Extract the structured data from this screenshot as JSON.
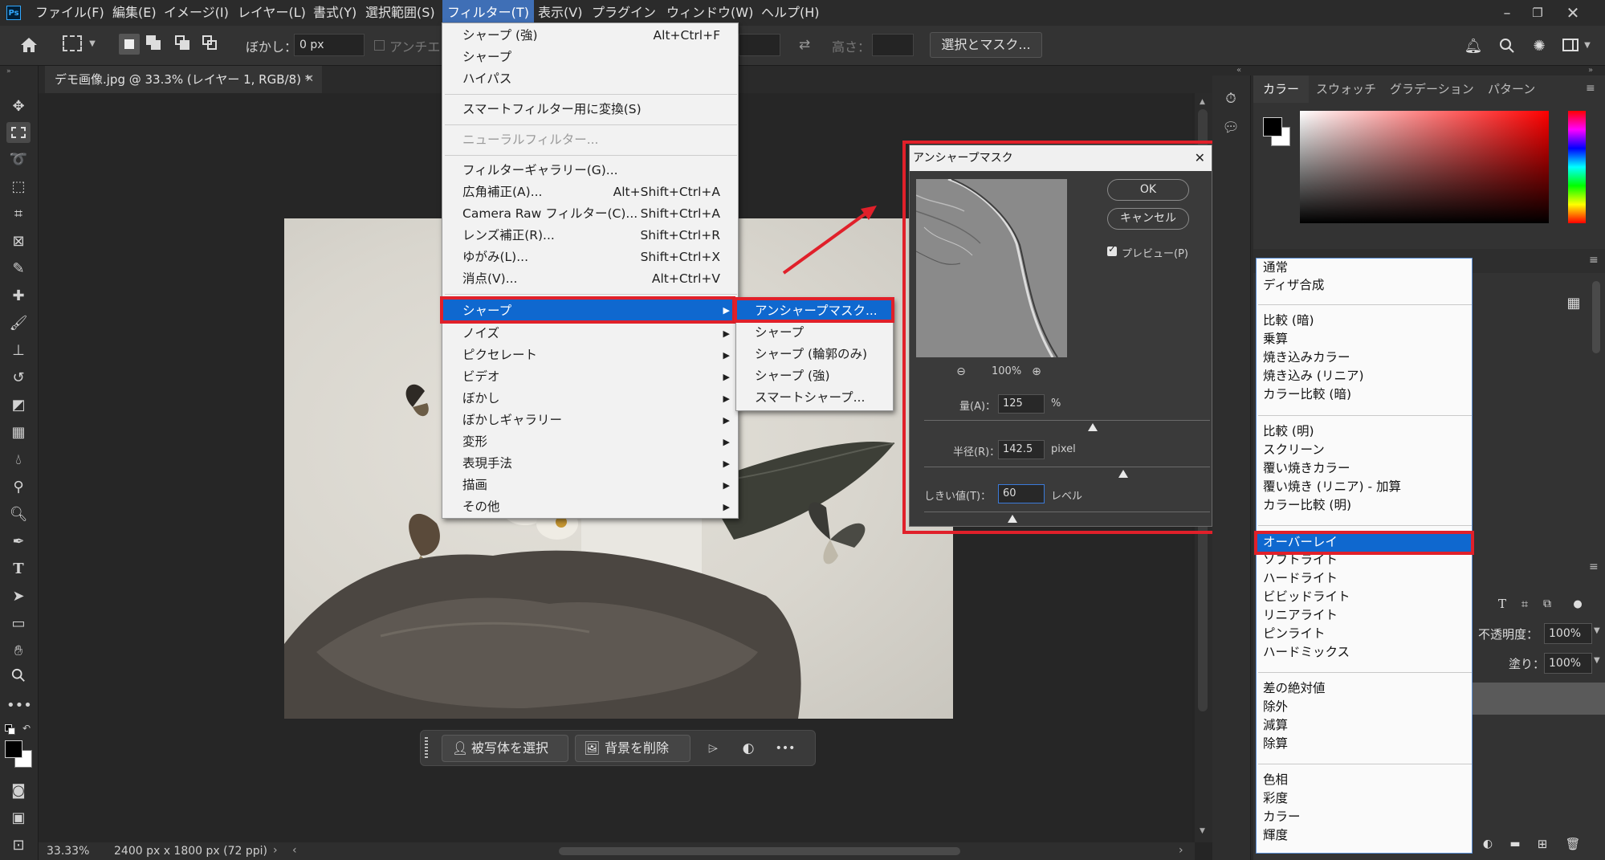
{
  "menubar": {
    "items": [
      "ファイル(F)",
      "編集(E)",
      "イメージ(I)",
      "レイヤー(L)",
      "書式(Y)",
      "選択範囲(S)",
      "フィルター(T)",
      "表示(V)",
      "プラグイン",
      "ウィンドウ(W)",
      "ヘルプ(H)"
    ],
    "active_index": 6
  },
  "options": {
    "blur_label": "ぼかし：",
    "blur_value": "0 px",
    "antialias_label": "アンチエ",
    "height_label": "高さ：",
    "select_mask_button": "選択とマスク..."
  },
  "document": {
    "tab_title": "デモ画像.jpg @ 33.3% (レイヤー 1, RGB/8) *"
  },
  "status": {
    "zoom": "33.33%",
    "doc_info": "2400 px x 1800 px (72 ppi)"
  },
  "context_bar": {
    "select_subject": "被写体を選択",
    "remove_bg": "背景を削除"
  },
  "filter_menu": {
    "items": [
      {
        "label": "シャープ (強)",
        "shortcut": "Alt+Ctrl+F"
      },
      {
        "label": "シャープ",
        "shortcut": ""
      },
      {
        "label": "ハイパス",
        "shortcut": ""
      },
      {
        "label": "スマートフィルター用に変換(S)",
        "shortcut": ""
      },
      {
        "label": "ニューラルフィルター...",
        "shortcut": ""
      },
      {
        "label": "フィルターギャラリー(G)...",
        "shortcut": ""
      },
      {
        "label": "広角補正(A)...",
        "shortcut": "Alt+Shift+Ctrl+A"
      },
      {
        "label": "Camera Raw フィルター(C)...",
        "shortcut": "Shift+Ctrl+A"
      },
      {
        "label": "レンズ補正(R)...",
        "shortcut": "Shift+Ctrl+R"
      },
      {
        "label": "ゆがみ(L)...",
        "shortcut": "Shift+Ctrl+X"
      },
      {
        "label": "消点(V)...",
        "shortcut": "Alt+Ctrl+V"
      },
      {
        "label": "シャープ",
        "shortcut": ""
      },
      {
        "label": "ノイズ",
        "shortcut": ""
      },
      {
        "label": "ピクセレート",
        "shortcut": ""
      },
      {
        "label": "ビデオ",
        "shortcut": ""
      },
      {
        "label": "ぼかし",
        "shortcut": ""
      },
      {
        "label": "ぼかしギャラリー",
        "shortcut": ""
      },
      {
        "label": "変形",
        "shortcut": ""
      },
      {
        "label": "表現手法",
        "shortcut": ""
      },
      {
        "label": "描画",
        "shortcut": ""
      },
      {
        "label": "その他",
        "shortcut": ""
      }
    ]
  },
  "sharpen_submenu": {
    "items": [
      "アンシャープマスク...",
      "シャープ",
      "シャープ (輪郭のみ)",
      "シャープ (強)",
      "スマートシャープ..."
    ]
  },
  "unsharp_dialog": {
    "title": "アンシャープマスク",
    "ok": "OK",
    "cancel": "キャンセル",
    "preview_label": "プレビュー(P)",
    "zoom": "100%",
    "amount_label": "量(A)：",
    "amount_value": "125",
    "amount_unit": "%",
    "radius_label": "半径(R)：",
    "radius_value": "142.5",
    "radius_unit": "pixel",
    "threshold_label": "しきい値(T)：",
    "threshold_value": "60",
    "threshold_unit": "レベル"
  },
  "color_panel": {
    "tabs": [
      "カラー",
      "スウォッチ",
      "グラデーション",
      "パターン"
    ]
  },
  "layers_panel": {
    "opacity_label": "不透明度：",
    "opacity_value": "100%",
    "fill_label": "塗り：",
    "fill_value": "100%"
  },
  "blend_modes": {
    "items": [
      "通常",
      "ディザ合成",
      "比較 (暗)",
      "乗算",
      "焼き込みカラー",
      "焼き込み (リニア)",
      "カラー比較 (暗)",
      "比較 (明)",
      "スクリーン",
      "覆い焼きカラー",
      "覆い焼き (リニア) - 加算",
      "カラー比較 (明)",
      "オーバーレイ",
      "ソフトライト",
      "ハードライト",
      "ビビッドライト",
      "リニアライト",
      "ピンライト",
      "ハードミックス",
      "差の絶対値",
      "除外",
      "減算",
      "除算",
      "色相",
      "彩度",
      "カラー",
      "輝度"
    ]
  }
}
